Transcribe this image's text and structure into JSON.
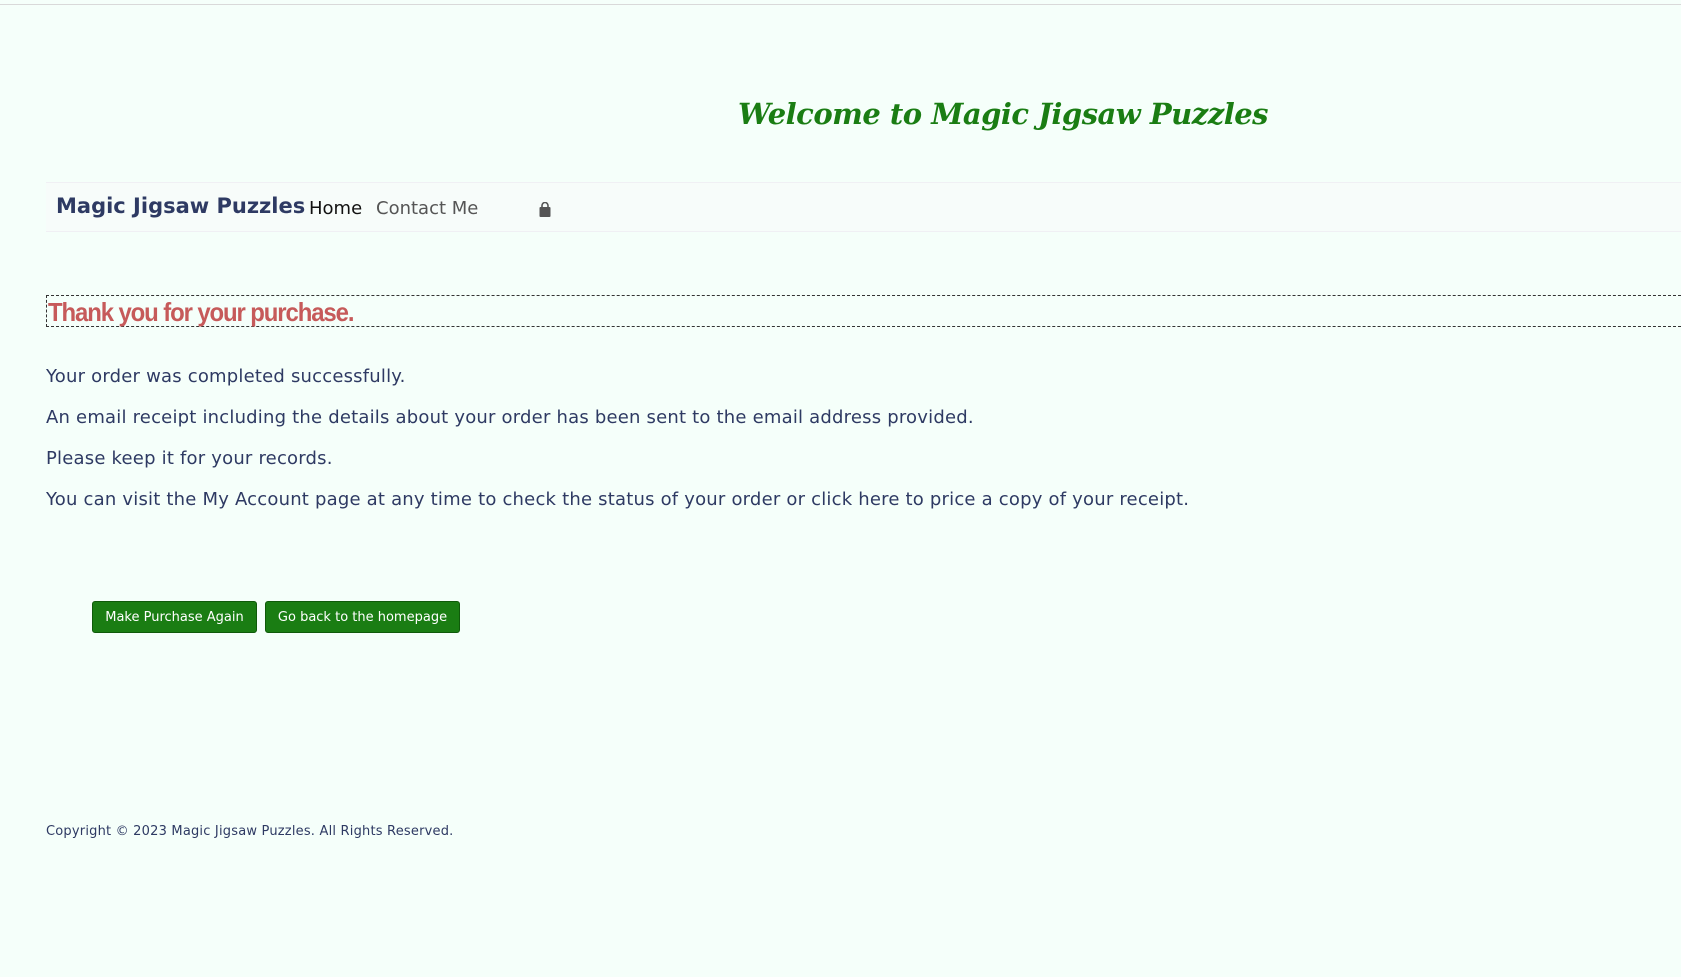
{
  "page": {
    "welcome": "Welcome to Magic Jigsaw Puzzles"
  },
  "nav": {
    "brand": "Magic Jigsaw Puzzles",
    "home": "Home",
    "contact": "Contact Me",
    "cart_icon": "shopping-bag-icon"
  },
  "main": {
    "heading": "Thank you for your purchase.",
    "messages": [
      "Your order was completed successfully.",
      "An email receipt including the details about your order has been sent to the email address provided.",
      "Please keep it for your records.",
      "You can visit the My Account page at any time to check the status of your order or click here to price a copy of your receipt."
    ]
  },
  "buttons": {
    "purchase_again": "Make Purchase Again",
    "homepage": "Go back to the homepage"
  },
  "footer": {
    "copyright": "Copyright © 2023 Magic Jigsaw Puzzles. All Rights Reserved."
  },
  "colors": {
    "background": "#f5fffa",
    "welcome": "#1a7d13",
    "heading": "#c65a5a",
    "text": "#2e3a63",
    "button": "#1a7d13"
  }
}
